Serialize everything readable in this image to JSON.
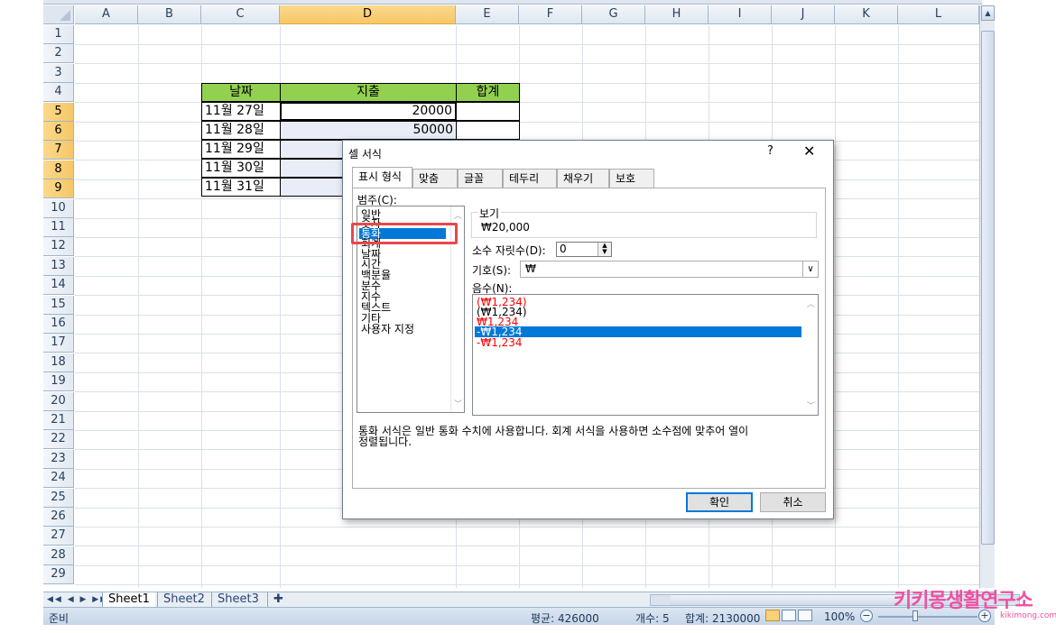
{
  "spreadsheet": {
    "columns": [
      "A",
      "B",
      "C",
      "D",
      "E",
      "F",
      "G",
      "H",
      "I",
      "J",
      "K",
      "L"
    ],
    "selected_column": "D",
    "rows": [
      "1",
      "2",
      "3",
      "4",
      "5",
      "6",
      "7",
      "8",
      "9",
      "10",
      "11",
      "12",
      "13",
      "14",
      "15",
      "16",
      "17",
      "18",
      "19",
      "20",
      "21",
      "22",
      "23",
      "24",
      "25",
      "26",
      "27",
      "28",
      "29"
    ],
    "selected_rows": [
      "5",
      "6",
      "7",
      "8",
      "9"
    ],
    "table": {
      "headers": [
        "날짜",
        "지출",
        "합계"
      ],
      "dates": [
        "11월 27일",
        "11월 28일",
        "11월 29일",
        "11월 30일",
        "11월 31일"
      ],
      "expenses": [
        "20000",
        "50000",
        "",
        "",
        ""
      ]
    },
    "sheet_tabs": [
      "Sheet1",
      "Sheet2",
      "Sheet3"
    ],
    "active_sheet": "Sheet1"
  },
  "status_bar": {
    "mode": "준비",
    "average": "평균: 426000",
    "count": "개수: 5",
    "sum": "합계: 2130000",
    "zoom": "100%"
  },
  "dialog": {
    "title": "셀 서식",
    "help": "?",
    "close": "✕",
    "tabs": [
      "표시 형식",
      "맞춤",
      "글꼴",
      "테두리",
      "채우기",
      "보호"
    ],
    "active_tab": "표시 형식",
    "category_label": "범주(C):",
    "categories": [
      "일반",
      "숫자",
      "통화",
      "회계",
      "날짜",
      "시간",
      "백분율",
      "분수",
      "지수",
      "텍스트",
      "기타",
      "사용자 지정"
    ],
    "selected_category": "통화",
    "preview_label": "보기",
    "preview_value": "₩20,000",
    "decimal_label": "소수 자릿수(D):",
    "decimal_value": "0",
    "symbol_label": "기호(S):",
    "symbol_value": "₩",
    "negative_label": "음수(N):",
    "negative_formats": [
      {
        "text": "(₩1,234)",
        "color": "red"
      },
      {
        "text": "(₩1,234)",
        "color": "black"
      },
      {
        "text": "₩1,234",
        "color": "red"
      },
      {
        "text": "-₩1,234",
        "color": "black"
      },
      {
        "text": "-₩1,234",
        "color": "red"
      }
    ],
    "selected_negative_index": 3,
    "description_line1": "통화 서식은 일반 통화 수치에 사용합니다. 회계 서식을 사용하면 소수점에 맞추어 열이",
    "description_line2": "정렬됩니다.",
    "ok_label": "확인",
    "cancel_label": "취소"
  },
  "watermark": {
    "text": "키키몽생활연구소",
    "url": "kikimong.com",
    "color": "#f04fa2"
  },
  "colors": {
    "header_fill": "#92d050",
    "selection_blue": "#0078d7",
    "highlight_red": "#e8474c"
  }
}
